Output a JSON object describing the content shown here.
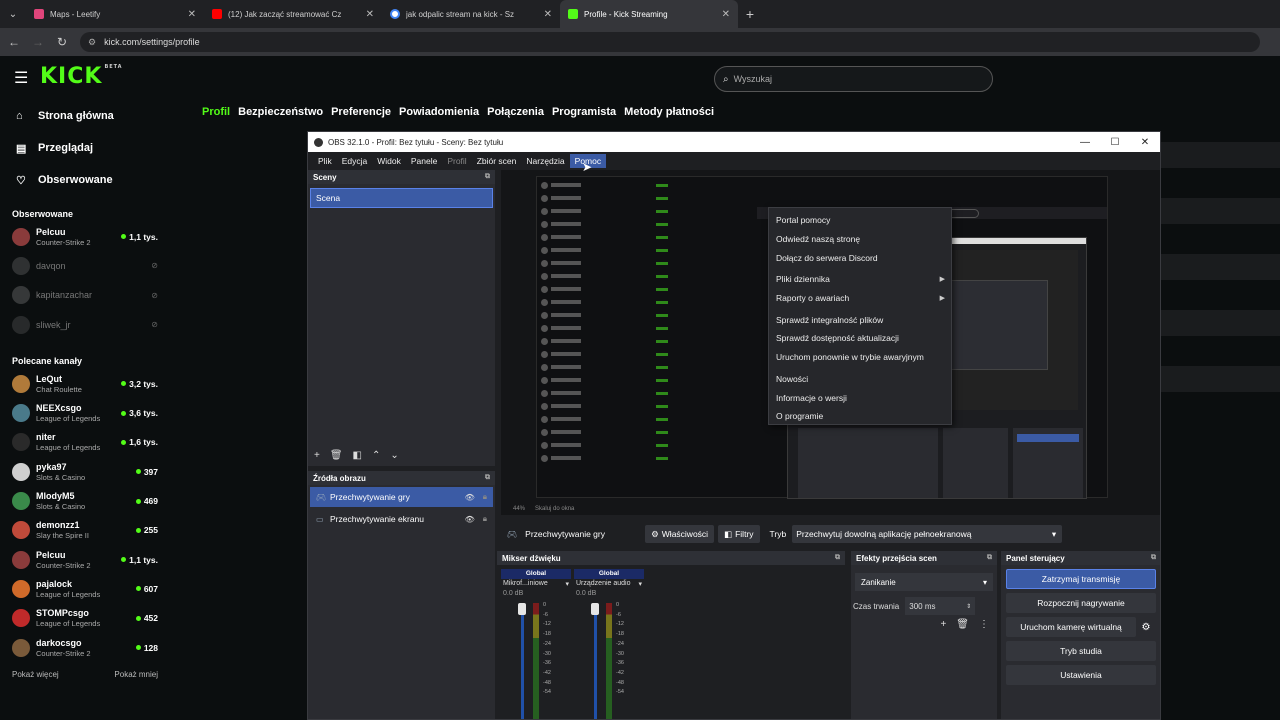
{
  "browser": {
    "tabs": [
      {
        "title": "Maps - Leetify",
        "color": "#e0457b"
      },
      {
        "title": "(12) Jak zacząć streamować Cz",
        "color": "#ff0000"
      },
      {
        "title": "jak odpalic stream na kick - Sz",
        "color": "#4285f4"
      },
      {
        "title": "Profile - Kick Streaming",
        "color": "#53fc18"
      }
    ],
    "url": "kick.com/settings/profile"
  },
  "kick": {
    "logo": "KICK",
    "logo_badge": "BETA",
    "search_placeholder": "Wyszukaj",
    "nav": [
      {
        "label": "Strona główna",
        "icon": "home-icon",
        "glyph": "⌂"
      },
      {
        "label": "Przeglądaj",
        "icon": "browse-icon",
        "glyph": "▤"
      },
      {
        "label": "Obserwowane",
        "icon": "heart-icon",
        "glyph": "♡"
      }
    ],
    "followed_header": "Obserwowane",
    "followed": [
      {
        "name": "Pelcuu",
        "category": "Counter-Strike 2",
        "viewers": "1,1 tys.",
        "live": true,
        "color": "#8a3b3b"
      },
      {
        "name": "davqon",
        "category": "",
        "viewers": "",
        "live": false,
        "color": "#666"
      },
      {
        "name": "kapitanzachar",
        "category": "",
        "viewers": "",
        "live": false,
        "color": "#777"
      },
      {
        "name": "sliwek_jr",
        "category": "",
        "viewers": "",
        "live": false,
        "color": "#555"
      }
    ],
    "recommended_header": "Polecane kanały",
    "recommended": [
      {
        "name": "LeQut",
        "category": "Chat Roulette",
        "viewers": "3,2 tys.",
        "color": "#b07a3a"
      },
      {
        "name": "NEEXcsgo",
        "category": "League of Legends",
        "viewers": "3,6 tys.",
        "color": "#4a7a8a"
      },
      {
        "name": "niter",
        "category": "League of Legends",
        "viewers": "1,6 tys.",
        "color": "#2a2a2a"
      },
      {
        "name": "pyka97",
        "category": "Slots & Casino",
        "viewers": "397",
        "color": "#cfcfcf"
      },
      {
        "name": "MlodyM5",
        "category": "Slots & Casino",
        "viewers": "469",
        "color": "#3a8a4a"
      },
      {
        "name": "demonzz1",
        "category": "Slay the Spire II",
        "viewers": "255",
        "color": "#c04a3a"
      },
      {
        "name": "Pelcuu",
        "category": "Counter-Strike 2",
        "viewers": "1,1 tys.",
        "color": "#8a3b3b"
      },
      {
        "name": "pajalock",
        "category": "League of Legends",
        "viewers": "607",
        "color": "#d06a2a"
      },
      {
        "name": "STOMPcsgo",
        "category": "League of Legends",
        "viewers": "452",
        "color": "#c02a2a"
      },
      {
        "name": "darkocsgo",
        "category": "Counter-Strike 2",
        "viewers": "128",
        "color": "#7a5a3a"
      }
    ],
    "show_more": "Pokaż więcej",
    "show_less": "Pokaż mniej",
    "settings_tabs": [
      "Profil",
      "Bezpieczeństwo",
      "Preferencje",
      "Powiadomienia",
      "Połączenia",
      "Programista",
      "Metody płatności"
    ],
    "active_tab": "Profil",
    "accent": "#53fc18"
  },
  "obs": {
    "title": "OBS 32.1.0 - Profil: Bez tytułu - Sceny: Bez tytułu",
    "menu": [
      "Plik",
      "Edycja",
      "Widok",
      "Panele",
      "Profil",
      "Zbiór scen",
      "Narzędzia",
      "Pomoc"
    ],
    "open_menu": "Pomoc",
    "help_menu": [
      {
        "label": "Portal pomocy",
        "sub": false
      },
      {
        "label": "Odwiedź naszą stronę",
        "sub": false
      },
      {
        "label": "Dołącz do serwera Discord",
        "sub": false
      },
      {
        "sep": true
      },
      {
        "label": "Pliki dziennika",
        "sub": true
      },
      {
        "label": "Raporty o awariach",
        "sub": true
      },
      {
        "sep": true
      },
      {
        "label": "Sprawdź integralność plików",
        "sub": false
      },
      {
        "label": "Sprawdź dostępność aktualizacji",
        "sub": false
      },
      {
        "label": "Uruchom ponownie w trybie awaryjnym",
        "sub": false
      },
      {
        "sep": true
      },
      {
        "label": "Nowości",
        "sub": false
      },
      {
        "label": "Informacje o wersji",
        "sub": false
      },
      {
        "label": "O programie",
        "sub": false
      }
    ],
    "scenes_title": "Sceny",
    "scenes": [
      "Scena"
    ],
    "sources_title": "Źródła obrazu",
    "sources": [
      {
        "label": "Przechwytywanie gry",
        "selected": true,
        "icon": "gamepad-icon"
      },
      {
        "label": "Przechwytywanie ekranu",
        "selected": false,
        "icon": "monitor-icon"
      }
    ],
    "preview_footer": [
      "44%",
      "Skaluj do okna"
    ],
    "selected_source": "Przechwytywanie gry",
    "properties_label": "Właściwości",
    "filters_label": "Filtry",
    "mode_label": "Tryb",
    "mode_value": "Przechwytuj dowolną aplikację pełnoekranową",
    "mixer_title": "Mikser dźwięku",
    "mixer_channels": [
      {
        "group": "Global",
        "name": "Mikrof...iniowe",
        "db": "0.0 dB"
      },
      {
        "group": "Global",
        "name": "Urządzenie audio",
        "db": "0.0 dB"
      }
    ],
    "mixer_ticks": [
      "0",
      "-6",
      "-12",
      "-18",
      "-24",
      "-30",
      "-36",
      "-42",
      "-48",
      "-54"
    ],
    "transitions_title": "Efekty przejścia scen",
    "transition": "Zanikanie",
    "duration_label": "Czas trwania",
    "duration_value": "300 ms",
    "controls_title": "Panel sterujący",
    "controls": [
      "Zatrzymaj transmisję",
      "Rozpocznij nagrywanie",
      "Uruchom kamerę wirtualną",
      "Tryb studia",
      "Ustawienia"
    ]
  }
}
